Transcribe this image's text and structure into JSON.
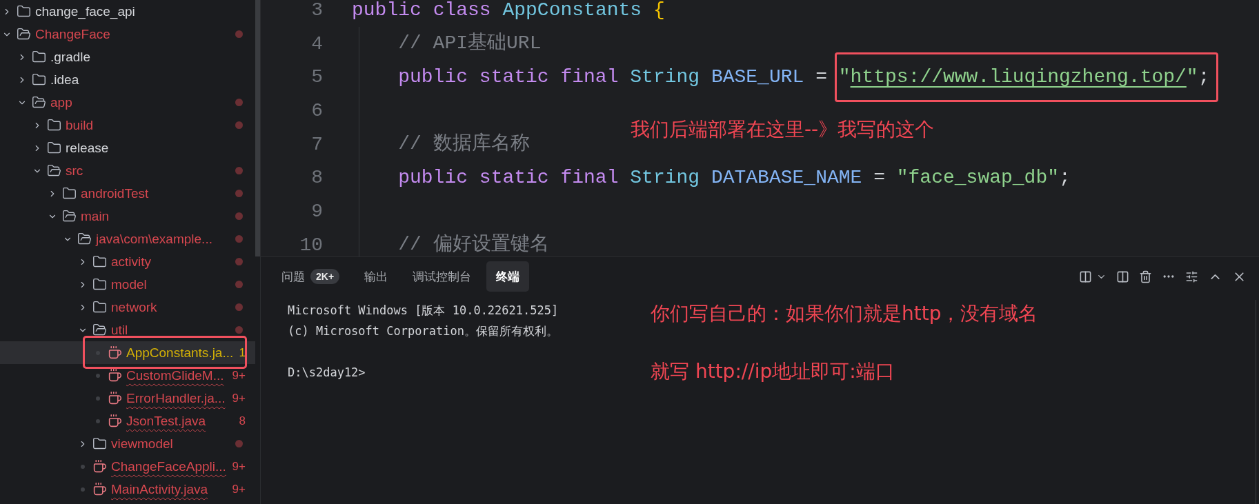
{
  "explorer": {
    "tree": [
      {
        "kind": "folder",
        "name": "change_face_api",
        "expanded": false,
        "color": "#d4d6da",
        "problems": false,
        "selected": false,
        "boxed": false
      },
      {
        "kind": "folder",
        "name": "ChangeFace",
        "expanded": true,
        "color": "#d6474f",
        "problems": true,
        "selected": false,
        "boxed": false,
        "children": [
          {
            "kind": "folder",
            "name": ".gradle",
            "expanded": false,
            "color": "#d4d6da",
            "problems": false,
            "selected": false,
            "boxed": false
          },
          {
            "kind": "folder",
            "name": ".idea",
            "expanded": false,
            "color": "#d4d6da",
            "problems": false,
            "selected": false,
            "boxed": false
          },
          {
            "kind": "folder",
            "name": "app",
            "expanded": true,
            "color": "#d6474f",
            "problems": true,
            "selected": false,
            "boxed": false,
            "children": [
              {
                "kind": "folder",
                "name": "build",
                "expanded": false,
                "color": "#d6474f",
                "problems": true,
                "selected": false,
                "boxed": false
              },
              {
                "kind": "folder",
                "name": "release",
                "expanded": false,
                "color": "#d4d6da",
                "problems": false,
                "selected": false,
                "boxed": false
              },
              {
                "kind": "folder",
                "name": "src",
                "expanded": true,
                "color": "#d6474f",
                "problems": true,
                "selected": false,
                "boxed": false,
                "children": [
                  {
                    "kind": "folder",
                    "name": "androidTest",
                    "expanded": false,
                    "color": "#d6474f",
                    "problems": true,
                    "selected": false,
                    "boxed": false
                  },
                  {
                    "kind": "folder",
                    "name": "main",
                    "expanded": true,
                    "color": "#d6474f",
                    "problems": true,
                    "selected": false,
                    "boxed": false,
                    "children": [
                      {
                        "kind": "folder",
                        "name": "java\\com\\example...",
                        "expanded": true,
                        "color": "#d6474f",
                        "problems": true,
                        "selected": false,
                        "boxed": false,
                        "children": [
                          {
                            "kind": "folder",
                            "name": "activity",
                            "expanded": false,
                            "color": "#d6474f",
                            "problems": true,
                            "selected": false,
                            "boxed": false
                          },
                          {
                            "kind": "folder",
                            "name": "model",
                            "expanded": false,
                            "color": "#d6474f",
                            "problems": true,
                            "selected": false,
                            "boxed": false
                          },
                          {
                            "kind": "folder",
                            "name": "network",
                            "expanded": false,
                            "color": "#d6474f",
                            "problems": true,
                            "selected": false,
                            "boxed": false
                          },
                          {
                            "kind": "folder",
                            "name": "util",
                            "expanded": true,
                            "color": "#d6474f",
                            "problems": true,
                            "selected": false,
                            "boxed": false,
                            "children": [
                              {
                                "kind": "file",
                                "name": "AppConstants.ja...",
                                "color": "#d4b106",
                                "problems": false,
                                "badge": "1",
                                "selected": true,
                                "boxed": true
                              },
                              {
                                "kind": "file",
                                "name": "CustomGlideM...",
                                "color": "#d6474f",
                                "problems": true,
                                "badge": "9+",
                                "selected": false,
                                "boxed": false
                              },
                              {
                                "kind": "file",
                                "name": "ErrorHandler.ja...",
                                "color": "#d6474f",
                                "problems": true,
                                "badge": "9+",
                                "selected": false,
                                "boxed": false
                              },
                              {
                                "kind": "file",
                                "name": "JsonTest.java",
                                "color": "#d6474f",
                                "problems": true,
                                "badge": "8",
                                "selected": false,
                                "boxed": false
                              }
                            ]
                          },
                          {
                            "kind": "folder",
                            "name": "viewmodel",
                            "expanded": false,
                            "color": "#d6474f",
                            "problems": true,
                            "selected": false,
                            "boxed": false
                          },
                          {
                            "kind": "file",
                            "name": "ChangeFaceAppli...",
                            "color": "#d6474f",
                            "problems": true,
                            "badge": "9+",
                            "selected": false,
                            "boxed": false
                          },
                          {
                            "kind": "file",
                            "name": "MainActivity.java",
                            "color": "#d6474f",
                            "problems": true,
                            "badge": "9+",
                            "selected": false,
                            "boxed": false
                          }
                        ]
                      }
                    ]
                  }
                ]
              }
            ]
          }
        ]
      }
    ]
  },
  "editor": {
    "lines": [
      {
        "number": "3",
        "indented": false,
        "tokens": [
          {
            "kind": "keyword",
            "text": "public "
          },
          {
            "kind": "keyword",
            "text": "class "
          },
          {
            "kind": "type",
            "text": "AppConstants "
          },
          {
            "kind": "brace",
            "text": "{"
          }
        ]
      },
      {
        "number": "4",
        "indented": true,
        "tokens": [
          {
            "kind": "comment",
            "text": "// API基础URL"
          }
        ]
      },
      {
        "number": "5",
        "indented": true,
        "tokens": [
          {
            "kind": "keyword",
            "text": "public "
          },
          {
            "kind": "keyword",
            "text": "static "
          },
          {
            "kind": "keyword",
            "text": "final "
          },
          {
            "kind": "type",
            "text": "String "
          },
          {
            "kind": "ident",
            "text": "BASE_URL "
          },
          {
            "kind": "op",
            "text": "= "
          }
        ],
        "boxed_tokens": [
          {
            "kind": "string",
            "text": "\""
          },
          {
            "kind": "link",
            "text": "https://www.liuqingzheng.top/"
          },
          {
            "kind": "string",
            "text": "\""
          },
          {
            "kind": "punct",
            "text": ";"
          }
        ]
      },
      {
        "number": "6",
        "indented": true
      },
      {
        "number": "7",
        "indented": true,
        "tokens": [
          {
            "kind": "comment",
            "text": "// 数据库名称"
          }
        ]
      },
      {
        "number": "8",
        "indented": true,
        "tokens": [
          {
            "kind": "keyword",
            "text": "public "
          },
          {
            "kind": "keyword",
            "text": "static "
          },
          {
            "kind": "keyword",
            "text": "final "
          },
          {
            "kind": "type",
            "text": "String "
          },
          {
            "kind": "ident",
            "text": "DATABASE_NAME "
          },
          {
            "kind": "op",
            "text": "= "
          },
          {
            "kind": "string",
            "text": "\"face_swap_db\""
          },
          {
            "kind": "punct",
            "text": ";"
          }
        ]
      },
      {
        "number": "9",
        "indented": true
      },
      {
        "number": "10",
        "indented": true,
        "tokens": [
          {
            "kind": "comment",
            "text": "// 偏好设置键名"
          }
        ]
      }
    ],
    "annotation": "我们后端部署在这里--》我写的这个"
  },
  "panel": {
    "tabs": [
      {
        "label": "问题",
        "badge": "2K+",
        "selected": false
      },
      {
        "label": "输出",
        "selected": false
      },
      {
        "label": "调试控制台",
        "selected": false
      },
      {
        "label": "终端",
        "selected": true
      }
    ],
    "terminal": {
      "output": [
        "Microsoft Windows [版本 10.0.22621.525]",
        "(c) Microsoft Corporation。保留所有权利。"
      ],
      "prompt": "D:\\s2day12>"
    },
    "annotations": [
      "你们写自己的：如果你们就是http，没有域名",
      "就写 http://ip地址即可:端口"
    ]
  }
}
